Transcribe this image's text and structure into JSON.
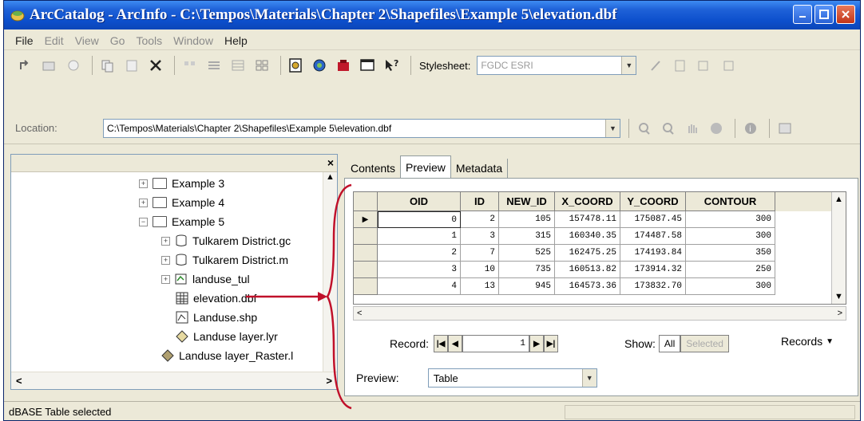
{
  "window": {
    "title": "ArcCatalog - ArcInfo - C:\\Tempos\\Materials\\Chapter 2\\Shapefiles\\Example 5\\elevation.dbf",
    "min_icon": "minimize-icon",
    "max_icon": "maximize-icon",
    "close_icon": "close-icon"
  },
  "menu": [
    "File",
    "Edit",
    "View",
    "Go",
    "Tools",
    "Window",
    "Help"
  ],
  "toolbar": {
    "stylesheet_label": "Stylesheet:",
    "stylesheet_value": "FGDC ESRI"
  },
  "location": {
    "label": "Location:",
    "value": "C:\\Tempos\\Materials\\Chapter 2\\Shapefiles\\Example 5\\elevation.dbf"
  },
  "tree": {
    "items": [
      {
        "label": "Example 3",
        "expander": "+"
      },
      {
        "label": "Example 4",
        "expander": "+"
      },
      {
        "label": "Example 5",
        "expander": "−"
      },
      {
        "label": "Tulkarem District.gc",
        "expander": "+"
      },
      {
        "label": "Tulkarem District.m",
        "expander": "+"
      },
      {
        "label": "landuse_tul",
        "expander": "+"
      },
      {
        "label": "elevation.dbf",
        "expander": ""
      },
      {
        "label": "Landuse.shp",
        "expander": ""
      },
      {
        "label": "Landuse layer.lyr",
        "expander": ""
      },
      {
        "label": "Landuse layer_Raster.l",
        "expander": ""
      }
    ]
  },
  "tabs": [
    "Contents",
    "Preview",
    "Metadata"
  ],
  "table": {
    "columns": [
      "OID",
      "ID",
      "NEW_ID",
      "X_COORD",
      "Y_COORD",
      "CONTOUR"
    ],
    "rows": [
      [
        "0",
        "2",
        "105",
        "157478.11",
        "175087.45",
        "300"
      ],
      [
        "1",
        "3",
        "315",
        "160340.35",
        "174487.58",
        "300"
      ],
      [
        "2",
        "7",
        "525",
        "162475.25",
        "174193.84",
        "350"
      ],
      [
        "3",
        "10",
        "735",
        "160513.82",
        "173914.32",
        "250"
      ],
      [
        "4",
        "13",
        "945",
        "164573.36",
        "173832.70",
        "300"
      ]
    ]
  },
  "record_bar": {
    "record_label": "Record:",
    "record_value": "1",
    "show_label": "Show:",
    "all_label": "All",
    "selected_label": "Selected",
    "records_label": "Records"
  },
  "preview": {
    "label": "Preview:",
    "value": "Table"
  },
  "status": {
    "text": "dBASE Table selected"
  },
  "colors": {
    "title_bar": "#0c4fcc",
    "annotation": "#c0102a"
  }
}
